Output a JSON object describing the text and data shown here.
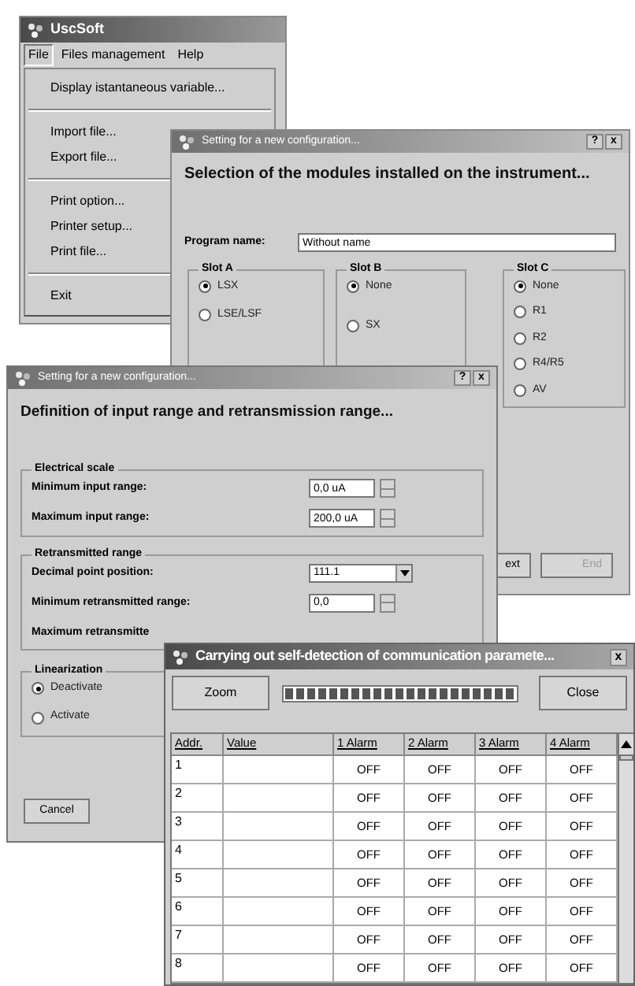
{
  "app_window": {
    "title": "UscSoft",
    "menus": [
      {
        "label": "File",
        "selected": true
      },
      {
        "label": "Files management",
        "selected": false
      },
      {
        "label": "Help",
        "selected": false
      }
    ],
    "file_menu": [
      {
        "kind": "item",
        "label": "Display istantaneous variable..."
      },
      {
        "kind": "separator"
      },
      {
        "kind": "item",
        "label": "Import file..."
      },
      {
        "kind": "item",
        "label": "Export file..."
      },
      {
        "kind": "separator"
      },
      {
        "kind": "item",
        "label": "Print option..."
      },
      {
        "kind": "item",
        "label": "Printer setup..."
      },
      {
        "kind": "item",
        "label": "Print file..."
      },
      {
        "kind": "separator"
      },
      {
        "kind": "item",
        "label": "Exit"
      }
    ]
  },
  "modules_window": {
    "title": "Setting for a new configuration...",
    "title_buttons": [
      "?",
      "x"
    ],
    "heading": "Selection of the modules installed on the instrument...",
    "program_name": {
      "label": "Program name:",
      "value": "Without name"
    },
    "slots": [
      {
        "label": "Slot A",
        "options": [
          {
            "label": "LSX",
            "selected": true
          },
          {
            "label": "LSE/LSF",
            "selected": false
          }
        ]
      },
      {
        "label": "Slot B",
        "options": [
          {
            "label": "None",
            "selected": true
          },
          {
            "label": "SX",
            "selected": false
          }
        ]
      },
      {
        "label": "Slot C",
        "options": [
          {
            "label": "None",
            "selected": true
          },
          {
            "label": "R1",
            "selected": false
          },
          {
            "label": "R2",
            "selected": false
          },
          {
            "label": "R4/R5",
            "selected": false
          },
          {
            "label": "AV",
            "selected": false
          }
        ]
      }
    ],
    "buttons": [
      {
        "label": "ext",
        "disabled": false
      },
      {
        "label": "End",
        "disabled": true
      }
    ]
  },
  "range_window": {
    "title": "Setting for a new configuration...",
    "title_buttons": [
      "?",
      "x"
    ],
    "heading": "Definition of input range and retransmission range...",
    "groups": [
      {
        "label": "Electrical scale",
        "fields": [
          {
            "kind": "spin",
            "label": "Minimum input range:",
            "value": "0,0 uA"
          },
          {
            "kind": "spin",
            "label": "Maximum input range:",
            "value": "200,0 uA"
          }
        ]
      },
      {
        "label": "Retransmitted range",
        "fields": [
          {
            "kind": "dropdown",
            "label": "Decimal point position:",
            "value": "111.1"
          },
          {
            "kind": "spin",
            "label": "Minimum retransmitted range:",
            "value": "0,0"
          },
          {
            "kind": "label",
            "label": "Maximum retransmitte"
          }
        ]
      }
    ],
    "linearization": {
      "label": "Linearization",
      "options": [
        {
          "label": "Deactivate",
          "selected": true
        },
        {
          "label": "Activate",
          "selected": false
        }
      ]
    },
    "cancel": "Cancel"
  },
  "detection_window": {
    "title": "Carrying out self-detection of communication paramete...",
    "close_glyph": "x",
    "zoom_button": "Zoom",
    "progress": {
      "level": 1
    },
    "close_button": "Close",
    "table": {
      "columns": [
        "Addr.",
        "Value",
        "1 Alarm",
        "2 Alarm",
        "3 Alarm",
        "4 Alarm"
      ],
      "rows": [
        {
          "addr": "1",
          "alarms": [
            "OFF",
            "OFF",
            "OFF",
            "OFF"
          ]
        },
        {
          "addr": "2",
          "alarms": [
            "OFF",
            "OFF",
            "OFF",
            "OFF"
          ]
        },
        {
          "addr": "3",
          "alarms": [
            "OFF",
            "OFF",
            "OFF",
            "OFF"
          ]
        },
        {
          "addr": "4",
          "alarms": [
            "OFF",
            "OFF",
            "OFF",
            "OFF"
          ]
        },
        {
          "addr": "5",
          "alarms": [
            "OFF",
            "OFF",
            "OFF",
            "OFF"
          ]
        },
        {
          "addr": "6",
          "alarms": [
            "OFF",
            "OFF",
            "OFF",
            "OFF"
          ]
        },
        {
          "addr": "7",
          "alarms": [
            "OFF",
            "OFF",
            "OFF",
            "OFF"
          ]
        },
        {
          "addr": "8",
          "alarms": [
            "OFF",
            "OFF",
            "OFF",
            "OFF"
          ]
        }
      ]
    }
  }
}
